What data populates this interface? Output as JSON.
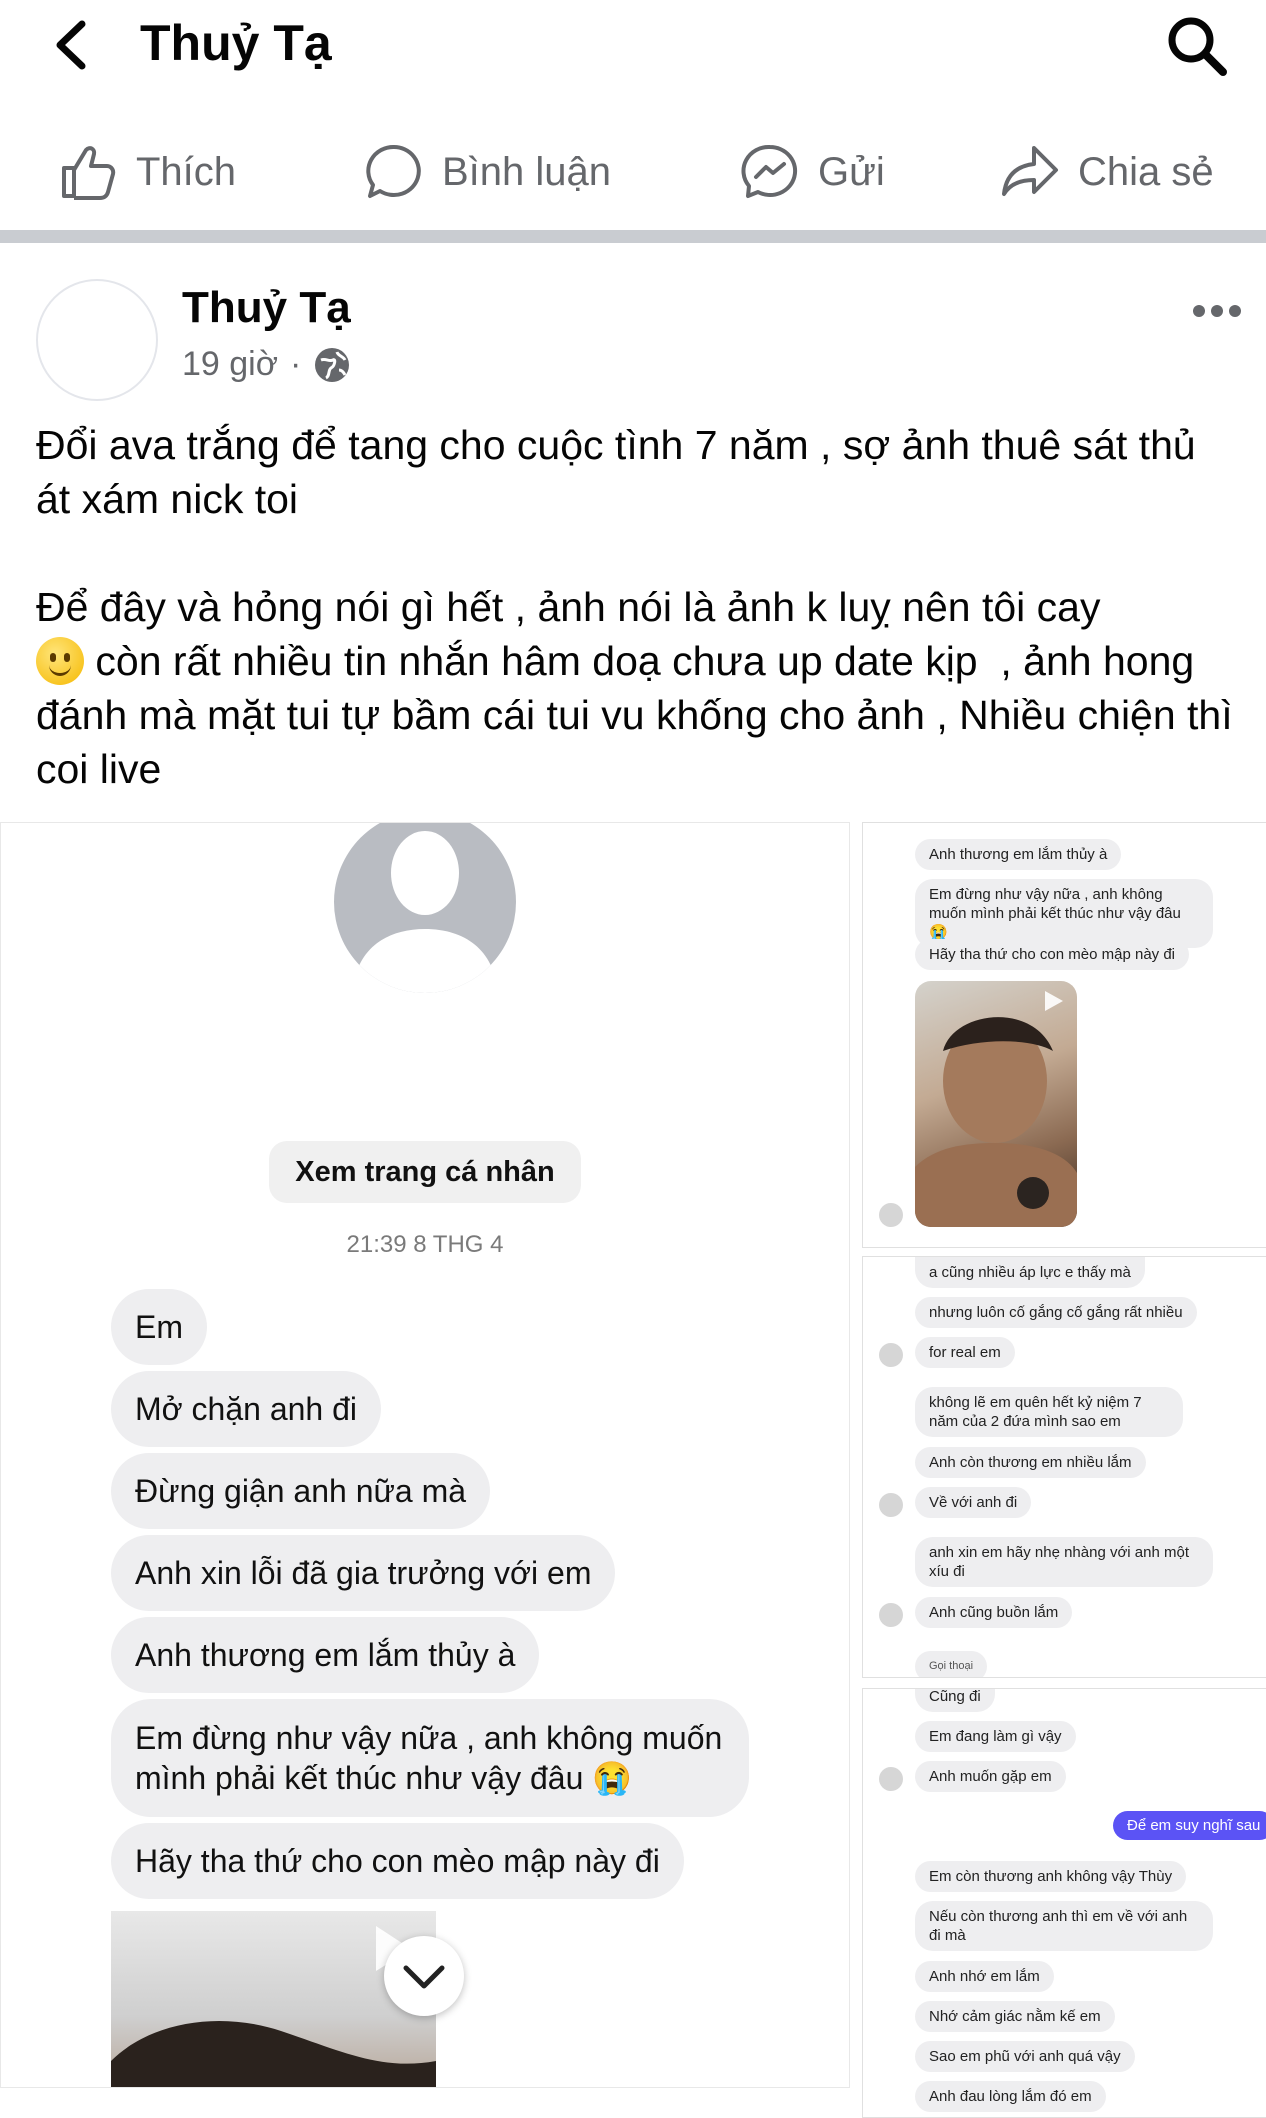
{
  "header": {
    "title": "Thuỷ Tạ"
  },
  "actions": [
    {
      "label": "Thích",
      "icon": "thumbs-up-icon"
    },
    {
      "label": "Bình luận",
      "icon": "comment-icon"
    },
    {
      "label": "Gửi",
      "icon": "messenger-icon"
    },
    {
      "label": "Chia sẻ",
      "icon": "share-icon"
    }
  ],
  "post": {
    "author": "Thuỷ Tạ",
    "time": "19 giờ",
    "dot": "·",
    "line1": "Đổi ava trắng để tang cho cuộc tình 7 năm , sợ ảnh thuê sát thủ át xám nick toi",
    "line2a": "Để đây và hỏng nói gì hết , ảnh nói là ảnh k luỵ nên tôi cay",
    "line2b": " còn rất nhiều tin nhắn hâm doạ chưa up date kịp  , ảnh hong đánh mà mặt tui tự bầm cái tui vu khống cho ảnh , Nhiều chiện thì coi live"
  },
  "chat_left": {
    "profile_button": "Xem trang cá nhân",
    "timestamp": "21:39 8 THG 4",
    "messages": [
      "Em",
      "Mở chặn anh đi",
      "Đừng giận anh nữa mà",
      "Anh xin lỗi đã gia trưởng với em",
      "Anh thương em lắm thủy à",
      "Em đừng như vậy nữa , anh không muốn mình phải kết thúc như vậy đâu 😭",
      "Hãy tha thứ cho con mèo mập này đi"
    ]
  },
  "chat_right_1": {
    "messages": [
      "Anh thương em lắm thủy à",
      "Em đừng như vậy nữa , anh không muốn mình phải kết thúc như vậy đâu 😭",
      "Hãy tha thứ cho con mèo mập này đi"
    ]
  },
  "chat_right_2": {
    "messages": [
      "a cũng nhiều áp lực e thấy mà",
      "nhưng luôn cố gắng cố gắng rất nhiều",
      "for real em",
      "không lẽ em quên hết kỷ niệm 7 năm của 2 đứa mình sao em",
      "Anh còn thương em nhiều lắm",
      "Về với anh đi",
      "anh xin em hãy nhẹ nhàng với anh một xíu đi",
      "Anh cũng buồn lắm",
      "Gọi thoại"
    ]
  },
  "chat_right_3": {
    "messages": [
      "Cũng đi",
      "Em đang làm gì vậy",
      "Anh muốn gặp em",
      "Để em suy nghĩ sau",
      "Em còn thương anh không vậy Thùy",
      "Nếu còn thương anh thì em về với anh đi mà",
      "Anh nhớ em lắm",
      "Nhớ cảm giác nằm kế em",
      "Sao em phũ với anh quá vậy",
      "Anh đau lòng lắm đó em"
    ]
  },
  "colors": {
    "accent_blue": "#5b53f5",
    "icon_gray": "#65676b",
    "bubble_gray": "#eeeef0"
  }
}
